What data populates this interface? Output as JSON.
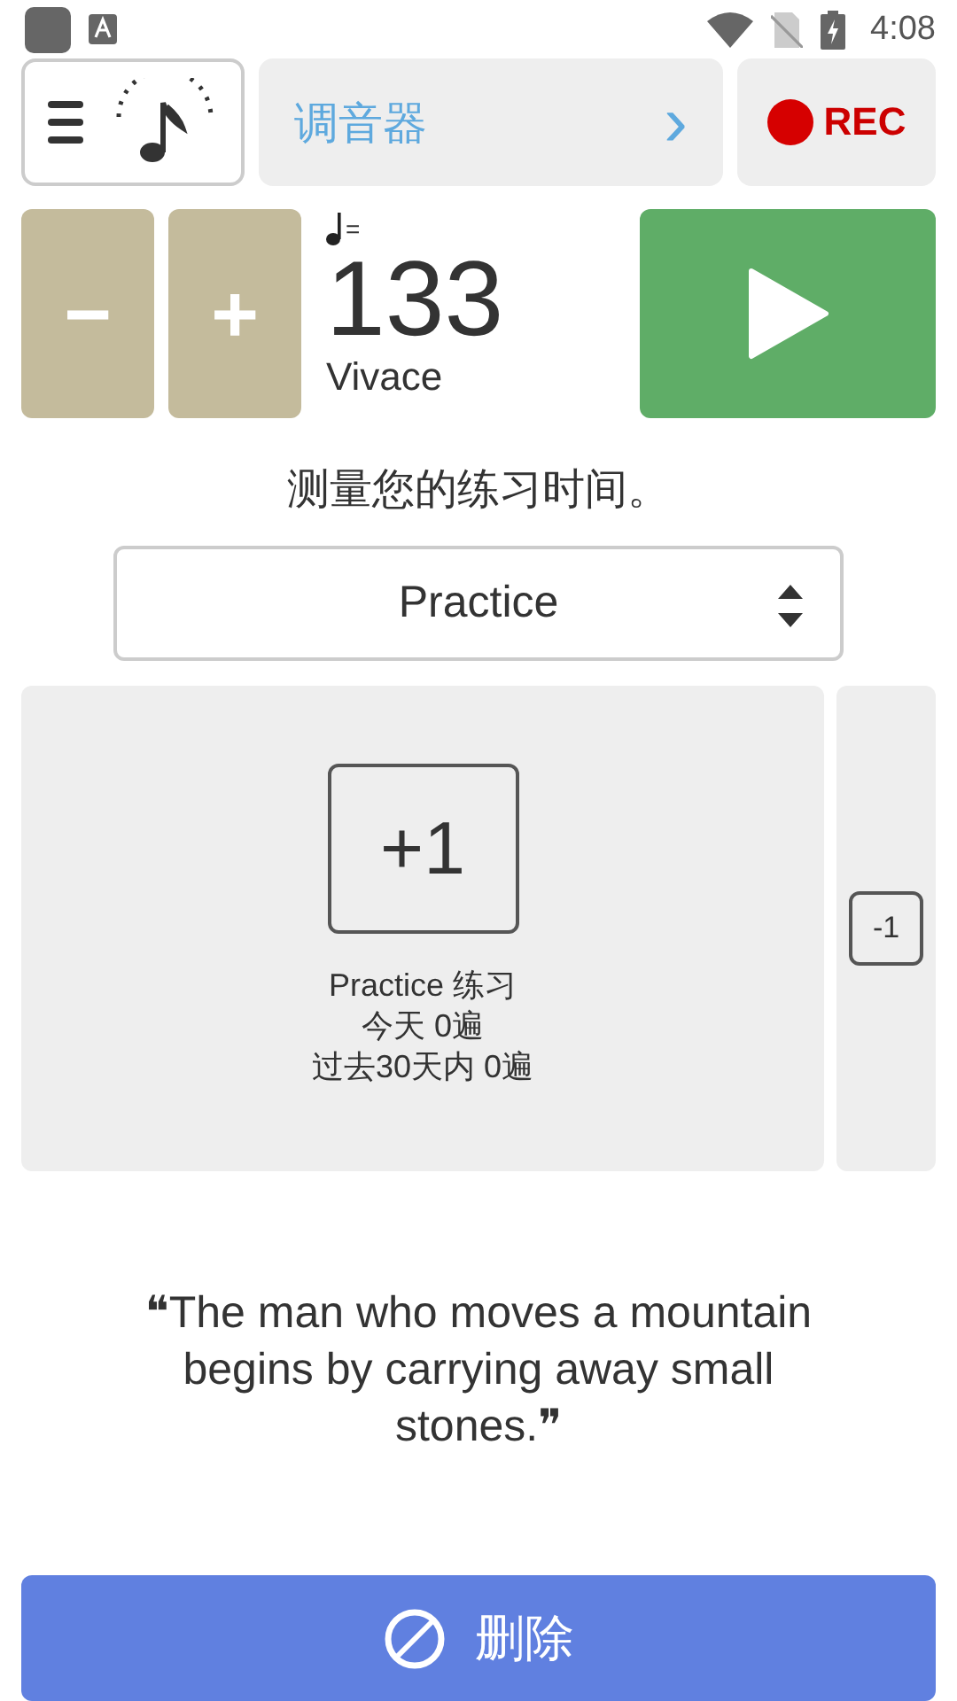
{
  "status_bar": {
    "time": "4:08"
  },
  "toolbar": {
    "tuner_label": "调音器",
    "chevron": "›",
    "rec_label": "REC"
  },
  "tempo": {
    "minus": "−",
    "plus": "+",
    "note_eq": "=",
    "bpm": "133",
    "marking": "Vivace"
  },
  "heading": "测量您的练习时间。",
  "selector": {
    "value": "Practice"
  },
  "counter": {
    "increment": "+1",
    "decrement": "-1",
    "lines": [
      {
        "text": "Practice 练习"
      },
      {
        "text": "今天 0遍"
      },
      {
        "text": "过去30天内 0遍"
      }
    ]
  },
  "quote": "❝The man who moves a mountain begins by carrying away small stones.❞",
  "ad_button": {
    "label": "删除"
  }
}
